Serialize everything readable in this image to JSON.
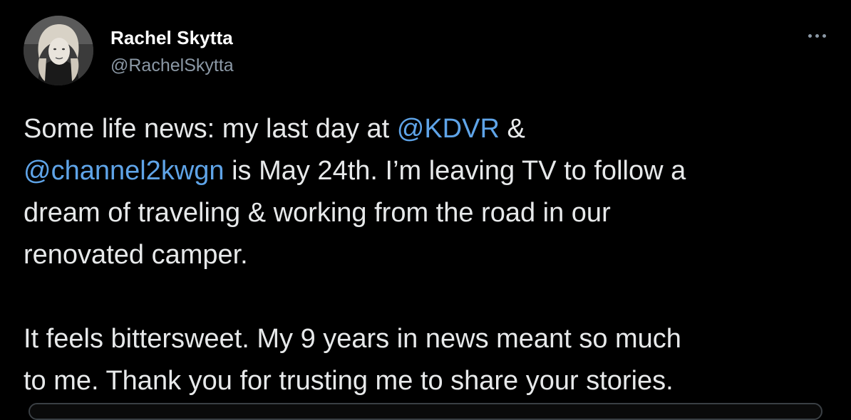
{
  "author": {
    "display_name": "Rachel Skytta",
    "handle": "@RachelSkytta",
    "avatar_icon": "profile-photo"
  },
  "menu": {
    "more_icon": "more-horizontal-icon"
  },
  "tweet": {
    "line1_pre": "Some life news: my last day at ",
    "mention1": "@KDVR",
    "line1_post": " &",
    "mention2": "@channel2kwgn",
    "line2_post": " is May 24th. I’m leaving TV to follow a",
    "line3": "dream of traveling & working from the road in our",
    "line4": "renovated camper.",
    "line5": "It feels bittersweet. My 9 years in news meant so much",
    "line6": "to me. Thank you for trusting me to share your stories."
  },
  "colors": {
    "background": "#000000",
    "text": "#e7e9ea",
    "secondary_text": "#8b98a5",
    "mention": "#5fa4e8"
  }
}
